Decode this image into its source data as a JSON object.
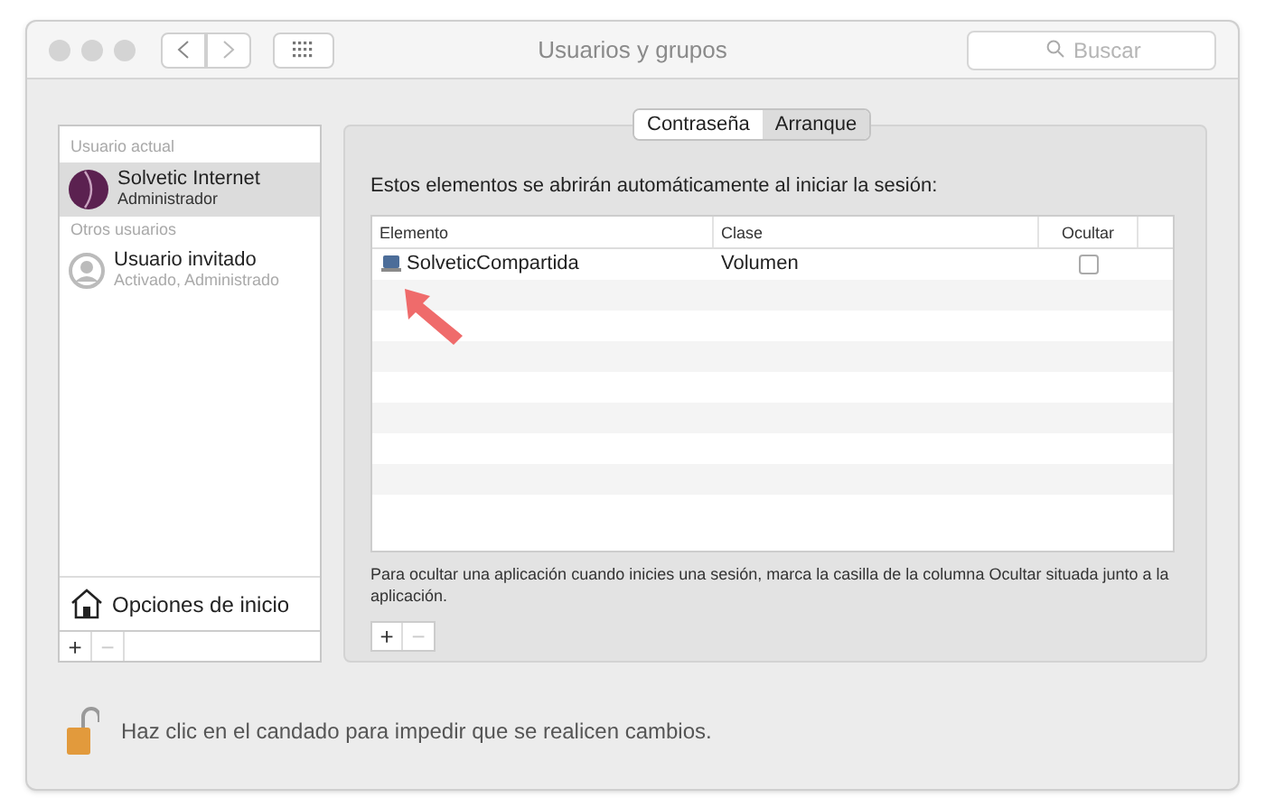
{
  "window": {
    "title": "Usuarios y grupos"
  },
  "search": {
    "placeholder": "Buscar"
  },
  "sidebar": {
    "sections": [
      {
        "heading": "Usuario actual",
        "users": [
          {
            "name": "Solvetic Internet",
            "role": "Administrador",
            "kind": "photo",
            "selected": true
          }
        ]
      },
      {
        "heading": "Otros usuarios",
        "users": [
          {
            "name": "Usuario invitado",
            "role": "Activado, Administrado",
            "kind": "guest",
            "selected": false
          }
        ]
      }
    ],
    "login_options": "Opciones de inicio",
    "add": "+",
    "remove": "−"
  },
  "tabs": [
    {
      "label": "Contraseña",
      "selected": false
    },
    {
      "label": "Arranque",
      "selected": true
    }
  ],
  "intro": "Estos elementos se abrirán automáticamente al iniciar la sesión:",
  "table": {
    "columns": [
      "Elemento",
      "Clase",
      "Ocultar"
    ],
    "rows": [
      {
        "item": "SolveticCompartida",
        "class": "Volumen",
        "hidden": false
      }
    ]
  },
  "hint": "Para ocultar una aplicación cuando inicies una sesión, marca la casilla de la columna Ocultar situada junto a la aplicación.",
  "table_add": "+",
  "table_remove": "−",
  "lock_text": "Haz clic en el candado para impedir que se realicen cambios."
}
